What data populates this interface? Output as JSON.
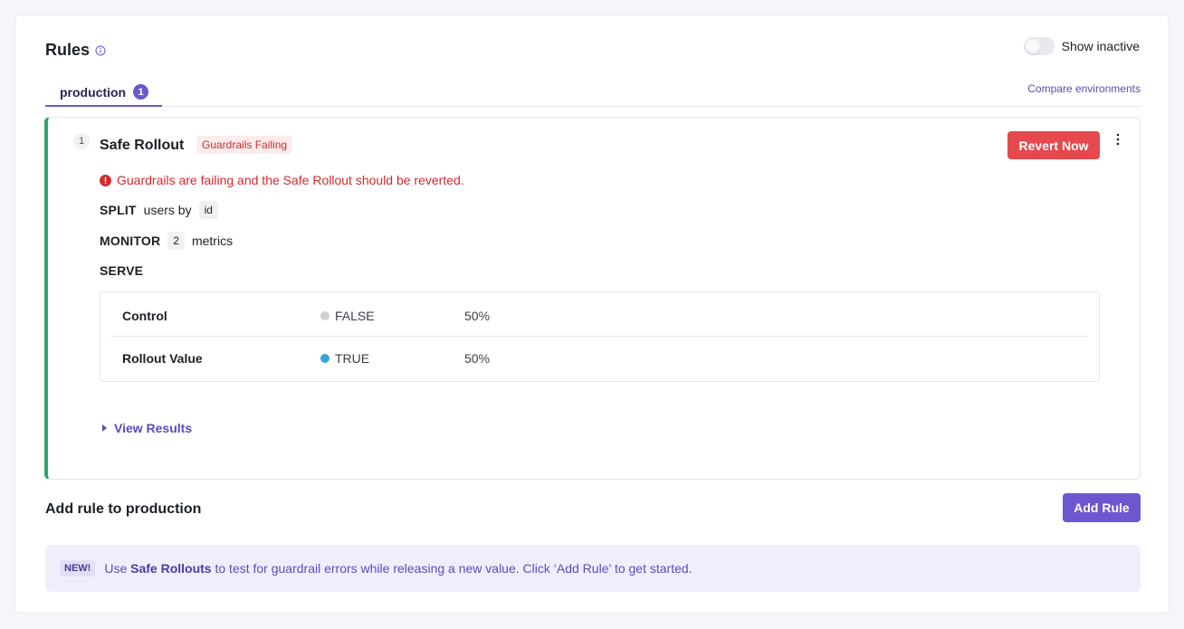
{
  "header": {
    "title": "Rules",
    "show_inactive_label": "Show inactive",
    "compare_link": "Compare environments"
  },
  "tabs": [
    {
      "label": "production",
      "count": "1",
      "active": true
    }
  ],
  "rule": {
    "number": "1",
    "title": "Safe Rollout",
    "status_badge": "Guardrails Failing",
    "revert_button": "Revert Now",
    "alert_text": "Guardrails are failing and the Safe Rollout should be reverted.",
    "split": {
      "key": "SPLIT",
      "text": "users by",
      "attribute": "id"
    },
    "monitor": {
      "key": "MONITOR",
      "count": "2",
      "text": "metrics"
    },
    "serve": {
      "key": "SERVE",
      "rows": [
        {
          "name": "Control",
          "value": "FALSE",
          "dot_color": "#cfcfcf",
          "percent": "50%"
        },
        {
          "name": "Rollout Value",
          "value": "TRUE",
          "dot_color": "#3aa3d9",
          "percent": "50%"
        }
      ]
    },
    "view_results": "View Results"
  },
  "add_rule": {
    "title": "Add rule to production",
    "button": "Add Rule"
  },
  "callout": {
    "badge": "NEW!",
    "prefix": "Use",
    "highlight": "Safe Rollouts",
    "suffix": "to test for guardrail errors while releasing a new value. Click ‘Add Rule’ to get started."
  },
  "colors": {
    "accent": "#6e56cf",
    "danger": "#e5484d",
    "success_bar": "#30a46c"
  }
}
